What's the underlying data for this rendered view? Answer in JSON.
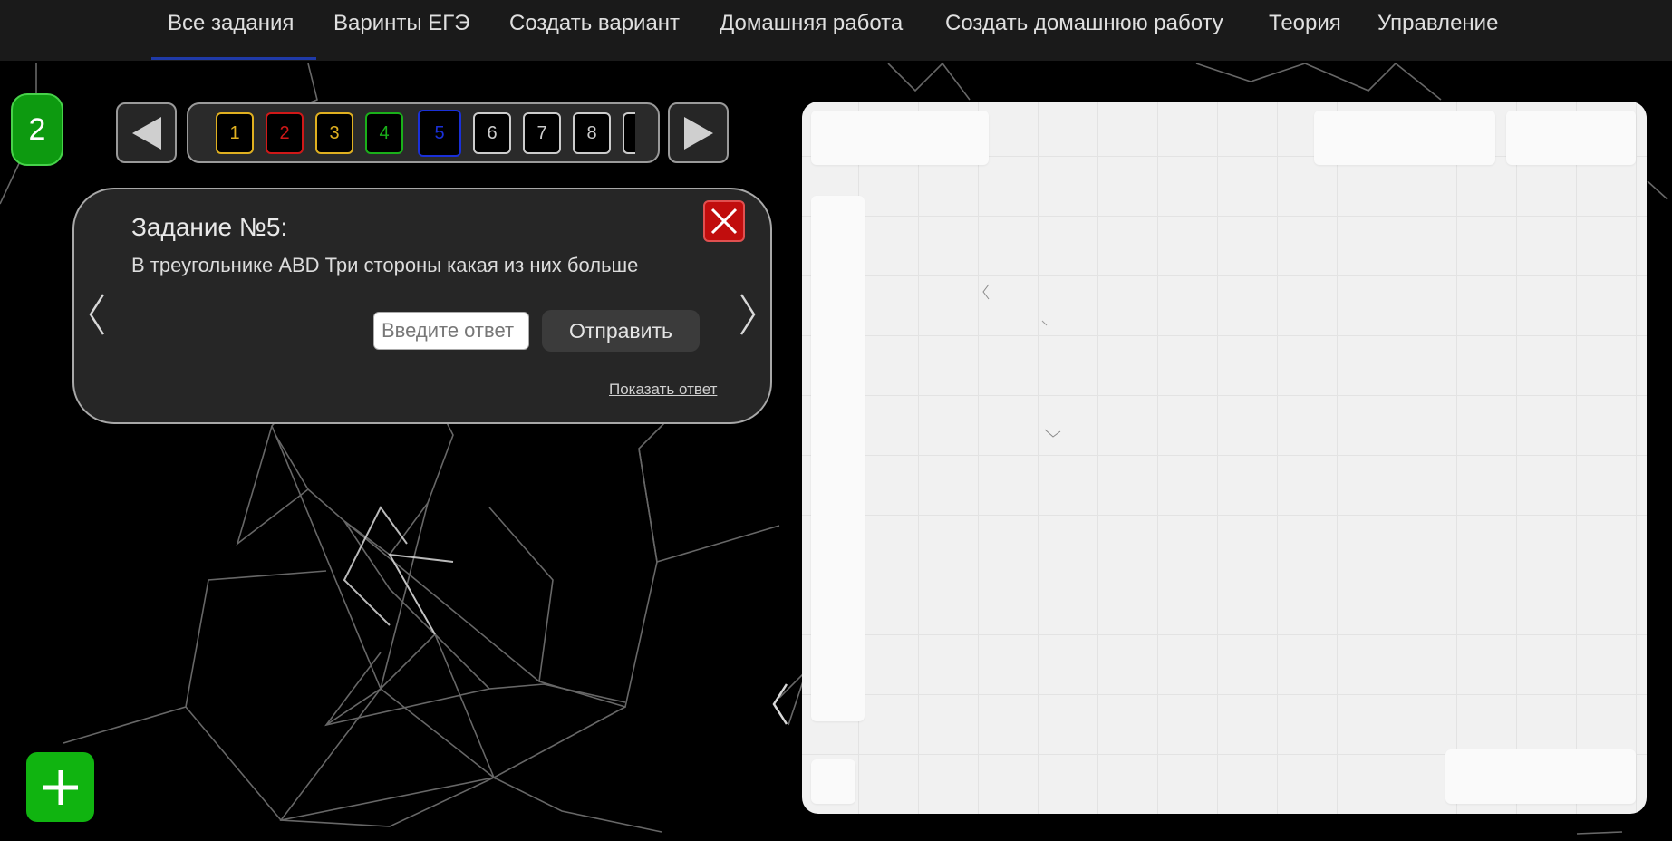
{
  "nav": {
    "items": [
      {
        "label": "Все задания",
        "active": true
      },
      {
        "label": "Варинты ЕГЭ"
      },
      {
        "label": "Создать вариант"
      },
      {
        "label": "Домашняя работа"
      },
      {
        "label": "Создать домашнюю работу"
      },
      {
        "label": "Теория"
      },
      {
        "label": "Управление"
      }
    ]
  },
  "counter": "2",
  "task_pills": [
    {
      "label": "1",
      "color": "#e0b020"
    },
    {
      "label": "2",
      "color": "#d01818"
    },
    {
      "label": "3",
      "color": "#e0b020"
    },
    {
      "label": "4",
      "color": "#1ab01a"
    },
    {
      "label": "5",
      "color": "#1a30d8",
      "selected": true
    },
    {
      "label": "6",
      "color": "#cccccc"
    },
    {
      "label": "7",
      "color": "#cccccc"
    },
    {
      "label": "8",
      "color": "#cccccc"
    }
  ],
  "task": {
    "title": "Задание №5:",
    "text": "В треугольнике ABD Три стороны какая из них больше",
    "answer_placeholder": "Введите ответ",
    "answer_value": "",
    "submit_label": "Отправить",
    "show_answer_label": "Показать ответ"
  },
  "colors": {
    "accent_green": "#10b410",
    "close_red": "#c10d0d",
    "nav_underline": "#1f3aa8"
  },
  "icons": {
    "prev": "triangle-left-icon",
    "next": "triangle-right-icon",
    "close": "close-icon",
    "add": "plus-icon"
  }
}
